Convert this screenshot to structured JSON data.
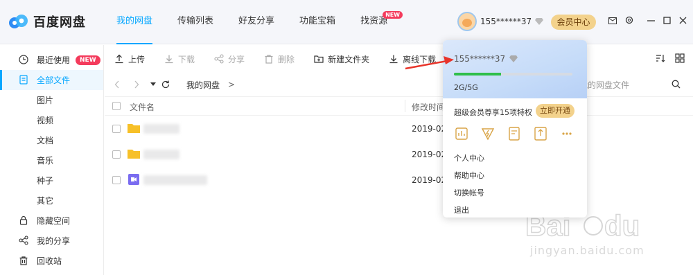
{
  "app": {
    "logo_text": "百度网盘"
  },
  "nav": [
    {
      "label": "我的网盘",
      "active": true
    },
    {
      "label": "传输列表"
    },
    {
      "label": "好友分享"
    },
    {
      "label": "功能宝箱"
    },
    {
      "label": "找资源",
      "badge": "NEW"
    }
  ],
  "header": {
    "username": "155******37",
    "vip_button": "会员中心"
  },
  "sidebar": {
    "recent": {
      "label": "最近使用",
      "badge": "NEW"
    },
    "all_files": "全部文件",
    "sub": [
      "图片",
      "视频",
      "文档",
      "音乐",
      "种子",
      "其它"
    ],
    "hidden": "隐藏空间",
    "share": "我的分享",
    "recycle": "回收站"
  },
  "toolbar": {
    "upload": "上传",
    "download": "下载",
    "share": "分享",
    "delete": "删除",
    "new_folder": "新建文件夹",
    "offline": "离线下载"
  },
  "address": {
    "crumb": "我的网盘",
    "sep": ">",
    "search_placeholder": "我的网盘文件"
  },
  "list": {
    "col_name": "文件名",
    "col_time": "修改时间",
    "rows": [
      {
        "type": "folder",
        "time": "2019-02-"
      },
      {
        "type": "folder",
        "time": "2019-02-"
      },
      {
        "type": "video",
        "time": "2019-02-"
      }
    ]
  },
  "popup": {
    "username": "155******37",
    "quota": "2G/5G",
    "quota_used_fraction": 0.4,
    "promo": "超级会员尊享15项特权",
    "open_button": "立即开通",
    "menu": [
      "个人中心",
      "帮助中心",
      "切换帐号",
      "退出"
    ]
  },
  "watermark": {
    "text": "Bai du 经验",
    "url": "jingyan.baidu.com"
  },
  "colors": {
    "accent": "#06a7ff",
    "badge": "#f43b5c",
    "gold": "#f3d28c",
    "progress": "#2fbf4a",
    "arrow": "#e8342a"
  }
}
